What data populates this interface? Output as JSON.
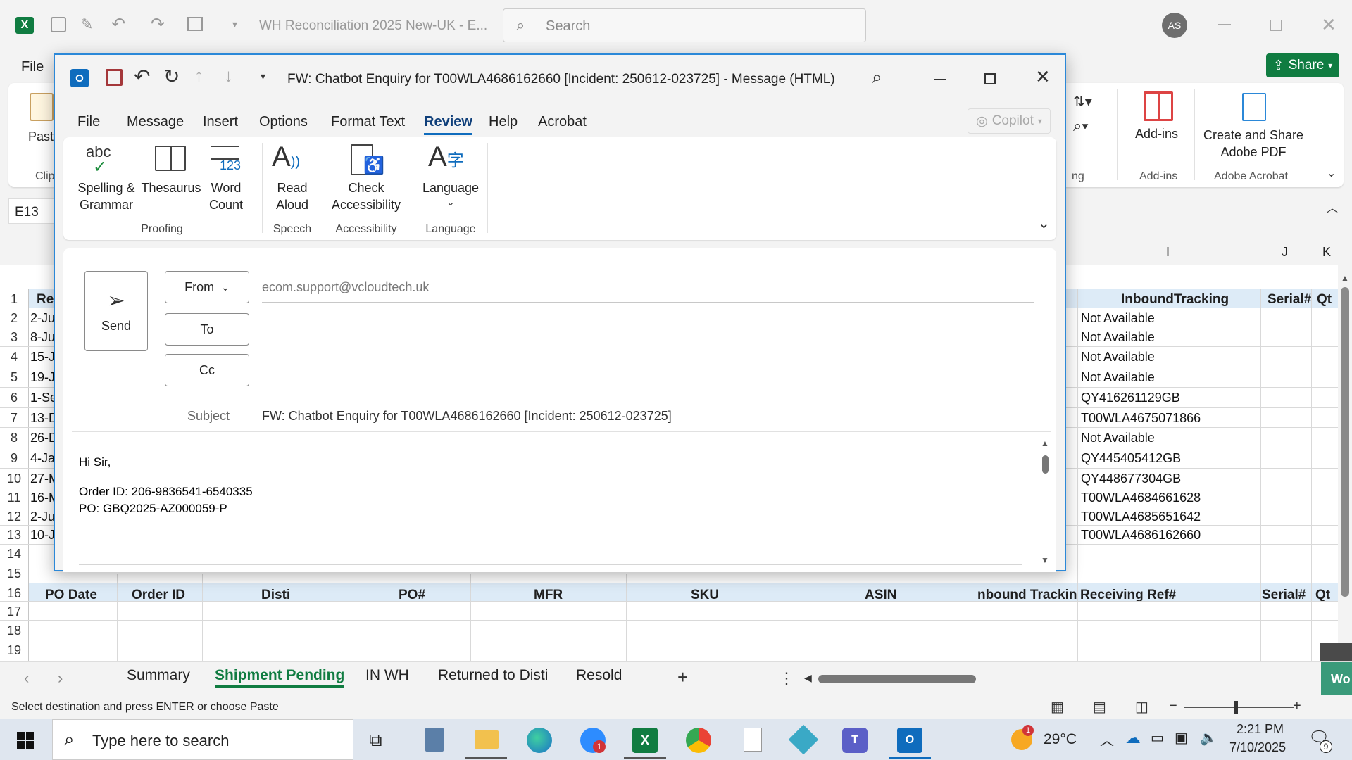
{
  "excel": {
    "title": "WH Reconciliation 2025 New-UK  -  E...",
    "search_placeholder": "Search",
    "avatar_initials": "AS",
    "menu_file": "File",
    "share_label": "Share",
    "ribbon": {
      "paste": "Paste",
      "clip": "Clip",
      "ng": "ng",
      "addins": "Add-ins",
      "addins_group": "Add-ins",
      "create_share": "Create and Share\nAdobe PDF",
      "adobe_group": "Adobe Acrobat"
    },
    "name_box": "E13",
    "columns": {
      "I": "I",
      "J": "J",
      "K": "K"
    },
    "row1": {
      "a": "Re",
      "inbound": "InboundTracking",
      "serial": "Serial#",
      "qt": "Qt"
    },
    "rows": [
      {
        "n": "1"
      },
      {
        "n": "2",
        "a": "2-Ju",
        "i": "Not Available"
      },
      {
        "n": "3",
        "a": "8-Ju",
        "i": "Not Available"
      },
      {
        "n": "4",
        "a": "15-J",
        "i": "Not Available"
      },
      {
        "n": "5",
        "a": "19-J",
        "i": "Not Available"
      },
      {
        "n": "6",
        "a": "1-Se",
        "i": "QY416261129GB"
      },
      {
        "n": "7",
        "a": "13-D",
        "i": "T00WLA4675071866"
      },
      {
        "n": "8",
        "a": "26-D",
        "i": "Not Available"
      },
      {
        "n": "9",
        "a": "4-Ja",
        "i": "QY445405412GB"
      },
      {
        "n": "10",
        "a": "27-M",
        "i": "QY448677304GB"
      },
      {
        "n": "11",
        "a": "16-M",
        "i": "T00WLA4684661628"
      },
      {
        "n": "12",
        "a": "2-Ju",
        "i": "T00WLA4685651642"
      },
      {
        "n": "13",
        "a": "10-J",
        "i": "T00WLA4686162660"
      },
      {
        "n": "14"
      },
      {
        "n": "15"
      },
      {
        "n": "16"
      },
      {
        "n": "17"
      },
      {
        "n": "18"
      },
      {
        "n": "19"
      }
    ],
    "row16_headers": [
      "PO Date",
      "Order ID",
      "Disti",
      "PO#",
      "MFR",
      "SKU",
      "ASIN",
      "nbound Trackin",
      "Receiving Ref#",
      "Serial#",
      "Qt"
    ],
    "sheet_tabs": [
      "Summary",
      "Shipment Pending",
      "IN WH",
      "Returned to Disti",
      "Resold"
    ],
    "status_text": "Select destination and press ENTER or choose Paste",
    "wo": "Wo"
  },
  "outlook": {
    "title": "FW: Chatbot Enquiry for T00WLA4686162660 [Incident: 250612-023725]  -  Message (HTML)",
    "menu": [
      "File",
      "Message",
      "Insert",
      "Options",
      "Format Text",
      "Review",
      "Help",
      "Acrobat"
    ],
    "copilot": "Copilot",
    "ribbon": {
      "spelling": "Spelling &\nGrammar",
      "thesaurus": "Thesaurus",
      "word_count": "Word\nCount",
      "read_aloud": "Read\nAloud",
      "check_access": "Check\nAccessibility",
      "language": "Language",
      "group_proofing": "Proofing",
      "group_speech": "Speech",
      "group_accessibility": "Accessibility",
      "group_language": "Language",
      "abc": "abc",
      "num123": "123"
    },
    "send": "Send",
    "from_label": "From",
    "from_value": "ecom.support@vcloudtech.uk",
    "to_label": "To",
    "cc_label": "Cc",
    "subject_label": "Subject",
    "subject_value": "FW: Chatbot Enquiry for T00WLA4686162660 [Incident: 250612-023725]",
    "body": {
      "greeting": "Hi Sir,",
      "order_id": "Order ID: 206-9836541-6540335",
      "po": "PO: GBQ2025-AZ000059-P"
    }
  },
  "taskbar": {
    "search_placeholder": "Type here to search",
    "temperature": "29°C",
    "time": "2:21 PM",
    "date": "7/10/2025",
    "weather_badge": "1",
    "zoom_badge": "1",
    "notif_count": "9"
  }
}
